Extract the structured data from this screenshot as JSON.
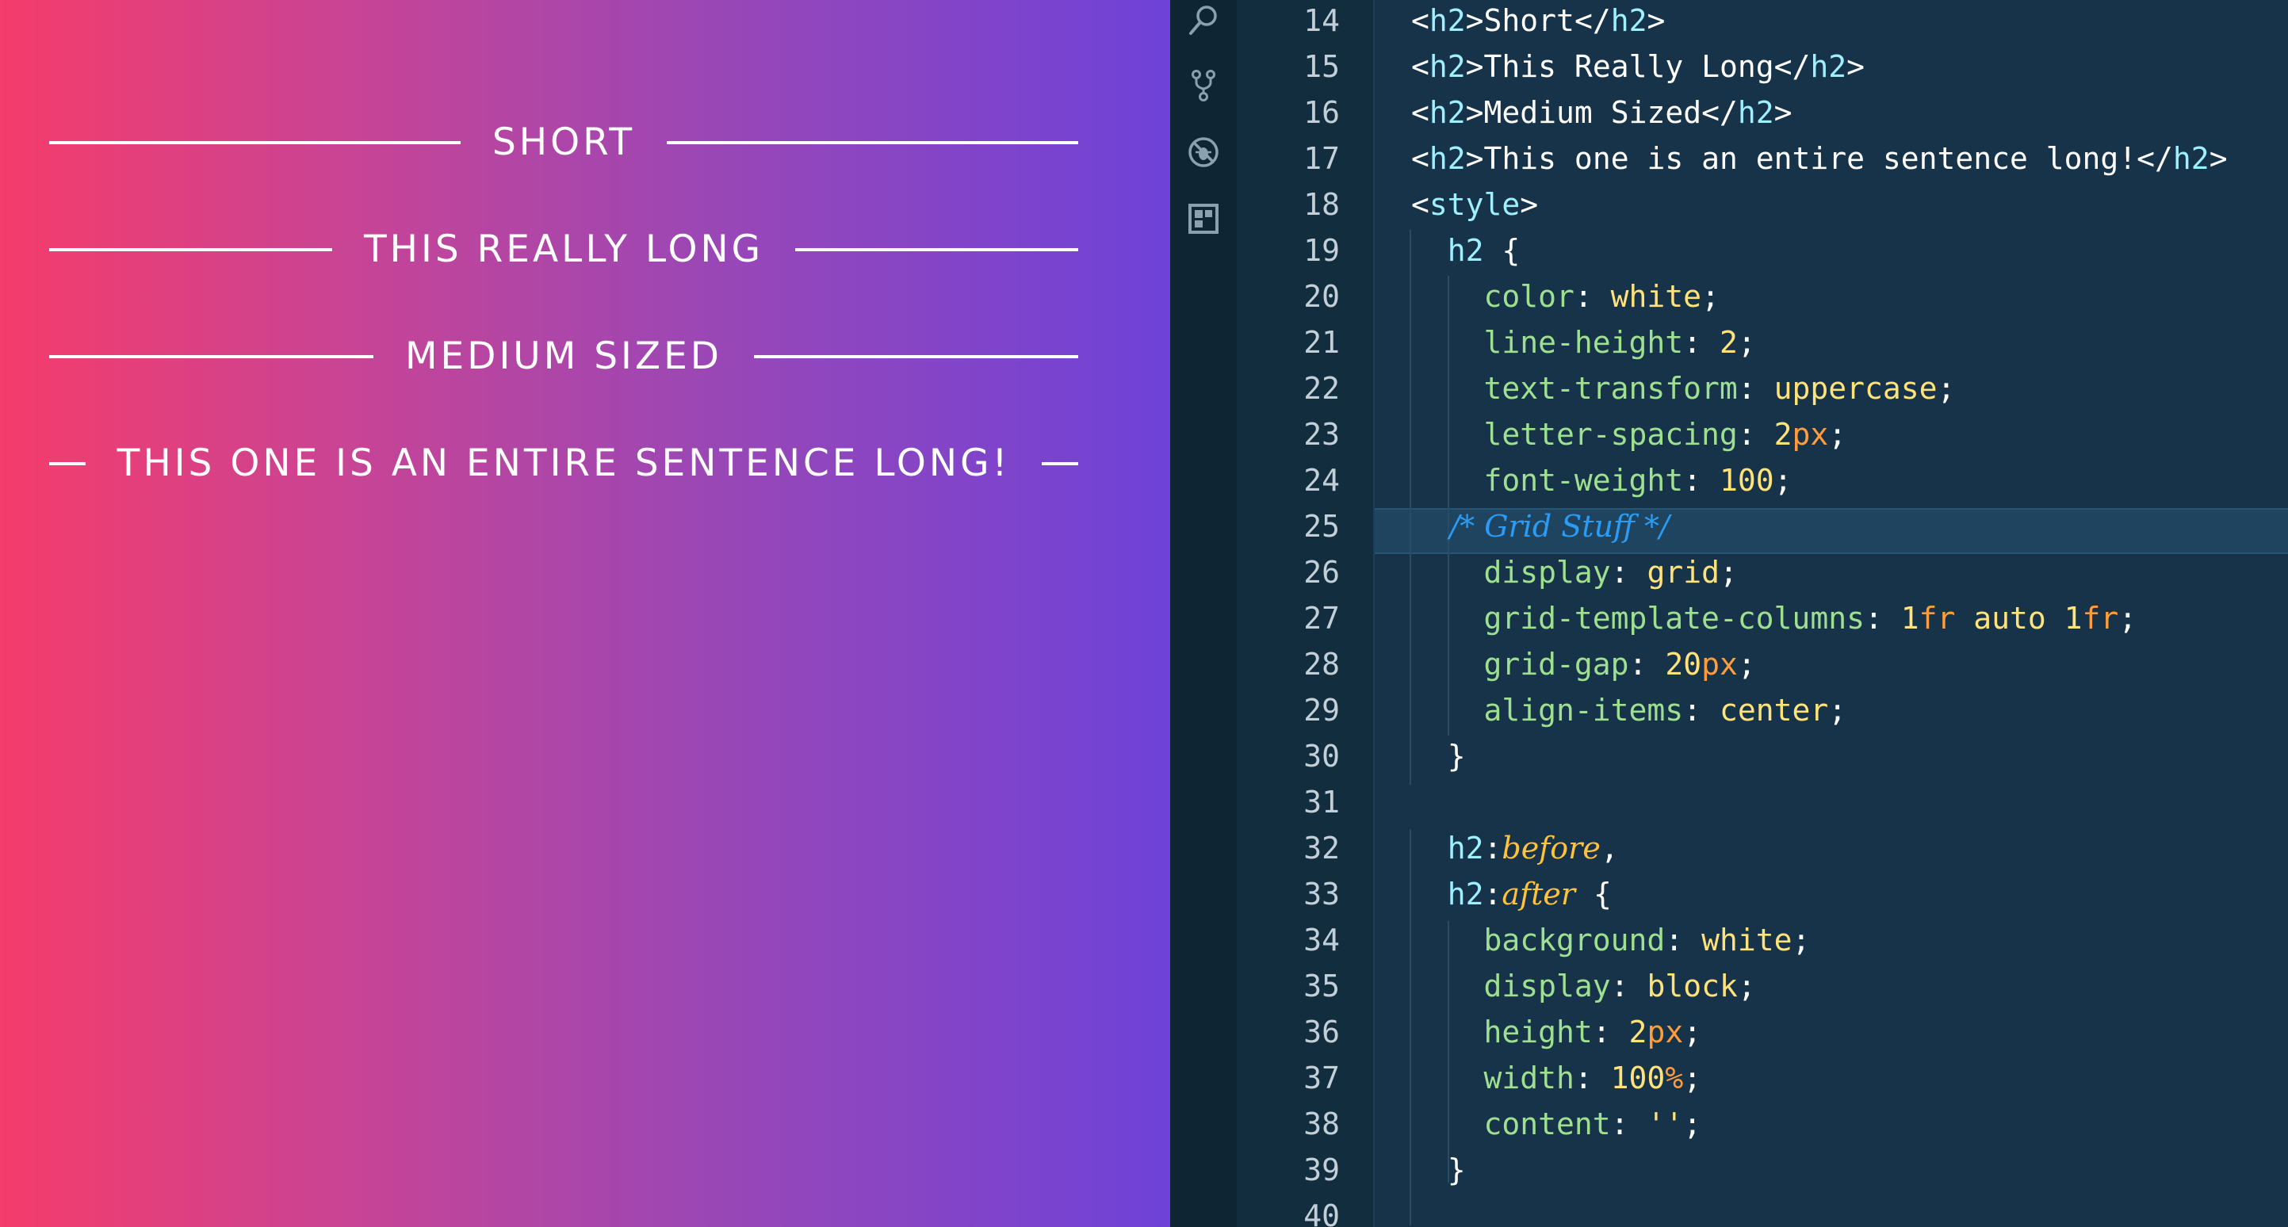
{
  "preview": {
    "headings": [
      {
        "text": "Short"
      },
      {
        "text": "This Really Long"
      },
      {
        "text": "Medium Sized"
      },
      {
        "text": "This one is an entire sentence long!"
      }
    ]
  },
  "activity_bar": {
    "icons": [
      "search-icon",
      "source-control-icon",
      "debug-icon",
      "extensions-icon"
    ]
  },
  "colors": {
    "gradient_start": "#f53c6b",
    "gradient_end": "#6e42d8",
    "editor_background": "#16334a",
    "property": "#9ee08f",
    "value": "#ffe27a",
    "unit": "#ff9d3c",
    "selector": "#9ff0ff",
    "pseudo": "#ffc23d",
    "comment": "#2a9cf5"
  },
  "editor": {
    "current_line": 25,
    "lines": [
      {
        "n": "14",
        "tokens": [
          {
            "c": "t-tag",
            "t": "<"
          },
          {
            "c": "t-name",
            "t": "h2"
          },
          {
            "c": "t-tag",
            "t": ">"
          },
          {
            "c": "t-txt",
            "t": "Short"
          },
          {
            "c": "t-tag",
            "t": "</"
          },
          {
            "c": "t-name",
            "t": "h2"
          },
          {
            "c": "t-tag",
            "t": ">"
          }
        ]
      },
      {
        "n": "15",
        "tokens": [
          {
            "c": "t-tag",
            "t": "<"
          },
          {
            "c": "t-name",
            "t": "h2"
          },
          {
            "c": "t-tag",
            "t": ">"
          },
          {
            "c": "t-txt",
            "t": "This Really Long"
          },
          {
            "c": "t-tag",
            "t": "</"
          },
          {
            "c": "t-name",
            "t": "h2"
          },
          {
            "c": "t-tag",
            "t": ">"
          }
        ]
      },
      {
        "n": "16",
        "tokens": [
          {
            "c": "t-tag",
            "t": "<"
          },
          {
            "c": "t-name",
            "t": "h2"
          },
          {
            "c": "t-tag",
            "t": ">"
          },
          {
            "c": "t-txt",
            "t": "Medium Sized"
          },
          {
            "c": "t-tag",
            "t": "</"
          },
          {
            "c": "t-name",
            "t": "h2"
          },
          {
            "c": "t-tag",
            "t": ">"
          }
        ]
      },
      {
        "n": "17",
        "tokens": [
          {
            "c": "t-tag",
            "t": "<"
          },
          {
            "c": "t-name",
            "t": "h2"
          },
          {
            "c": "t-tag",
            "t": ">"
          },
          {
            "c": "t-txt",
            "t": "This one is an entire sentence long!"
          },
          {
            "c": "t-tag",
            "t": "</"
          },
          {
            "c": "t-name",
            "t": "h2"
          },
          {
            "c": "t-tag",
            "t": ">"
          }
        ]
      },
      {
        "n": "18",
        "tokens": [
          {
            "c": "t-tag",
            "t": "<"
          },
          {
            "c": "t-name",
            "t": "style"
          },
          {
            "c": "t-tag",
            "t": ">"
          }
        ]
      },
      {
        "n": "19",
        "tokens": [
          {
            "c": "t-sel",
            "t": "  h2"
          },
          {
            "c": "t-punc",
            "t": " {"
          }
        ]
      },
      {
        "n": "20",
        "tokens": [
          {
            "c": "t-prop",
            "t": "    color"
          },
          {
            "c": "t-punc",
            "t": ": "
          },
          {
            "c": "t-val",
            "t": "white"
          },
          {
            "c": "t-punc",
            "t": ";"
          }
        ]
      },
      {
        "n": "21",
        "tokens": [
          {
            "c": "t-prop",
            "t": "    line-height"
          },
          {
            "c": "t-punc",
            "t": ": "
          },
          {
            "c": "t-num",
            "t": "2"
          },
          {
            "c": "t-punc",
            "t": ";"
          }
        ]
      },
      {
        "n": "22",
        "tokens": [
          {
            "c": "t-prop",
            "t": "    text-transform"
          },
          {
            "c": "t-punc",
            "t": ": "
          },
          {
            "c": "t-val",
            "t": "uppercase"
          },
          {
            "c": "t-punc",
            "t": ";"
          }
        ]
      },
      {
        "n": "23",
        "tokens": [
          {
            "c": "t-prop",
            "t": "    letter-spacing"
          },
          {
            "c": "t-punc",
            "t": ": "
          },
          {
            "c": "t-num",
            "t": "2"
          },
          {
            "c": "t-unit",
            "t": "px"
          },
          {
            "c": "t-punc",
            "t": ";"
          }
        ]
      },
      {
        "n": "24",
        "tokens": [
          {
            "c": "t-prop",
            "t": "    font-weight"
          },
          {
            "c": "t-punc",
            "t": ": "
          },
          {
            "c": "t-num",
            "t": "100"
          },
          {
            "c": "t-punc",
            "t": ";"
          }
        ]
      },
      {
        "n": "25",
        "tokens": [
          {
            "c": "t-cmt",
            "t": "    /* Grid Stuff */"
          }
        ]
      },
      {
        "n": "26",
        "tokens": [
          {
            "c": "t-prop",
            "t": "    display"
          },
          {
            "c": "t-punc",
            "t": ": "
          },
          {
            "c": "t-val",
            "t": "grid"
          },
          {
            "c": "t-punc",
            "t": ";"
          }
        ]
      },
      {
        "n": "27",
        "tokens": [
          {
            "c": "t-prop",
            "t": "    grid-template-columns"
          },
          {
            "c": "t-punc",
            "t": ": "
          },
          {
            "c": "t-num",
            "t": "1"
          },
          {
            "c": "t-unit",
            "t": "fr"
          },
          {
            "c": "t-val",
            "t": " auto "
          },
          {
            "c": "t-num",
            "t": "1"
          },
          {
            "c": "t-unit",
            "t": "fr"
          },
          {
            "c": "t-punc",
            "t": ";"
          }
        ]
      },
      {
        "n": "28",
        "tokens": [
          {
            "c": "t-prop",
            "t": "    grid-gap"
          },
          {
            "c": "t-punc",
            "t": ": "
          },
          {
            "c": "t-num",
            "t": "20"
          },
          {
            "c": "t-unit",
            "t": "px"
          },
          {
            "c": "t-punc",
            "t": ";"
          }
        ]
      },
      {
        "n": "29",
        "tokens": [
          {
            "c": "t-prop",
            "t": "    align-items"
          },
          {
            "c": "t-punc",
            "t": ": "
          },
          {
            "c": "t-val",
            "t": "center"
          },
          {
            "c": "t-punc",
            "t": ";"
          }
        ]
      },
      {
        "n": "30",
        "tokens": [
          {
            "c": "t-punc",
            "t": "  }"
          }
        ]
      },
      {
        "n": "31",
        "tokens": []
      },
      {
        "n": "32",
        "tokens": [
          {
            "c": "t-sel",
            "t": "  h2"
          },
          {
            "c": "t-punc",
            "t": ":"
          },
          {
            "c": "t-pseudo",
            "t": "before"
          },
          {
            "c": "t-punc",
            "t": ","
          }
        ]
      },
      {
        "n": "33",
        "tokens": [
          {
            "c": "t-sel",
            "t": "  h2"
          },
          {
            "c": "t-punc",
            "t": ":"
          },
          {
            "c": "t-pseudo",
            "t": "after"
          },
          {
            "c": "t-punc",
            "t": " {"
          }
        ]
      },
      {
        "n": "34",
        "tokens": [
          {
            "c": "t-prop",
            "t": "    background"
          },
          {
            "c": "t-punc",
            "t": ": "
          },
          {
            "c": "t-val",
            "t": "white"
          },
          {
            "c": "t-punc",
            "t": ";"
          }
        ]
      },
      {
        "n": "35",
        "tokens": [
          {
            "c": "t-prop",
            "t": "    display"
          },
          {
            "c": "t-punc",
            "t": ": "
          },
          {
            "c": "t-val",
            "t": "block"
          },
          {
            "c": "t-punc",
            "t": ";"
          }
        ]
      },
      {
        "n": "36",
        "tokens": [
          {
            "c": "t-prop",
            "t": "    height"
          },
          {
            "c": "t-punc",
            "t": ": "
          },
          {
            "c": "t-num",
            "t": "2"
          },
          {
            "c": "t-unit",
            "t": "px"
          },
          {
            "c": "t-punc",
            "t": ";"
          }
        ]
      },
      {
        "n": "37",
        "tokens": [
          {
            "c": "t-prop",
            "t": "    width"
          },
          {
            "c": "t-punc",
            "t": ": "
          },
          {
            "c": "t-num",
            "t": "100"
          },
          {
            "c": "t-unit",
            "t": "%"
          },
          {
            "c": "t-punc",
            "t": ";"
          }
        ]
      },
      {
        "n": "38",
        "tokens": [
          {
            "c": "t-prop",
            "t": "    content"
          },
          {
            "c": "t-punc",
            "t": ": "
          },
          {
            "c": "t-val",
            "t": "''"
          },
          {
            "c": "t-punc",
            "t": ";"
          }
        ]
      },
      {
        "n": "39",
        "tokens": [
          {
            "c": "t-punc",
            "t": "  }"
          }
        ]
      },
      {
        "n": "40",
        "tokens": []
      }
    ]
  }
}
